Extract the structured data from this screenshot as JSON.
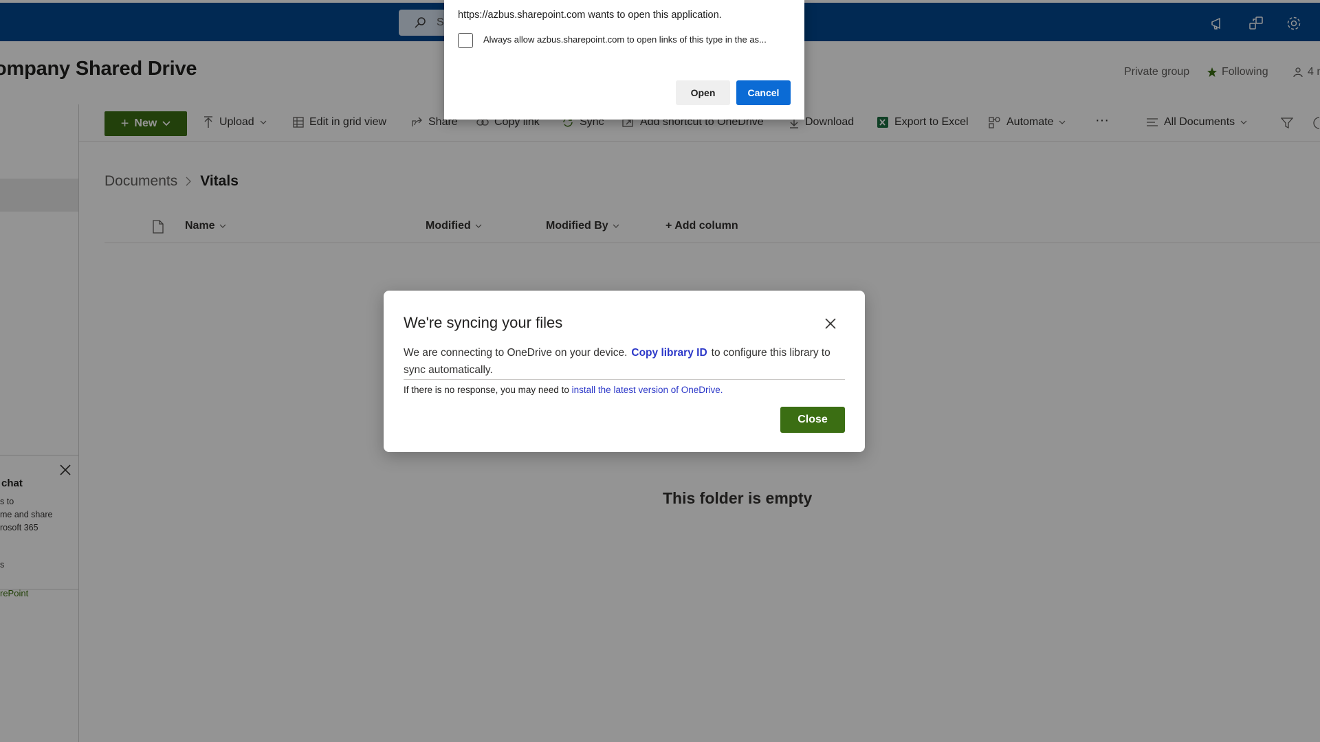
{
  "suite": {
    "search_placeholder": "S",
    "icons": [
      "megaphone-icon",
      "share-icon",
      "settings-icon"
    ]
  },
  "site": {
    "title": "ompany Shared Drive",
    "privacy": "Private group",
    "follow_label": "Following",
    "members_label": "4 m"
  },
  "leftnav": {
    "chat_card": {
      "title": "chat",
      "lines": [
        "s to",
        "me and share",
        "rosoft 365",
        "s"
      ]
    },
    "sharepoint_link": "rePoint"
  },
  "commandbar": {
    "new_label": "New",
    "upload_label": "Upload",
    "edit_grid_label": "Edit in grid view",
    "share_label": "Share",
    "copy_link_label": "Copy link",
    "sync_label": "Sync",
    "add_shortcut_label": "Add shortcut to OneDrive",
    "download_label": "Download",
    "export_label": "Export to Excel",
    "automate_label": "Automate",
    "more_label": "···",
    "view_label": "All Documents"
  },
  "breadcrumb": {
    "parent": "Documents",
    "separator": ">",
    "current": "Vitals"
  },
  "columns": {
    "name": "Name",
    "modified": "Modified",
    "modified_by": "Modified By",
    "add_column": "+ Add column"
  },
  "empty_message": "This folder is empty",
  "sync_dialog": {
    "title": "We're syncing your files",
    "body_prefix": "We are connecting to OneDrive on your device.",
    "body_link": "Copy library ID",
    "body_suffix": "to configure this library to sync automatically.",
    "note_prefix": "If there is no response, you may need to",
    "note_link": "install the latest version of OneDrive.",
    "close_label": "Close"
  },
  "protocol_dialog": {
    "message": "https://azbus.sharepoint.com wants to open this application.",
    "checkbox_label": "Always allow azbus.sharepoint.com to open links of this type in the as...",
    "checkbox_checked": false,
    "open_label": "Open",
    "cancel_label": "Cancel"
  },
  "colors": {
    "suite_bar": "#03488f",
    "primary_green": "#3b6e13",
    "link_blue": "#2b37c8",
    "browser_blue": "#0b6bd5"
  }
}
